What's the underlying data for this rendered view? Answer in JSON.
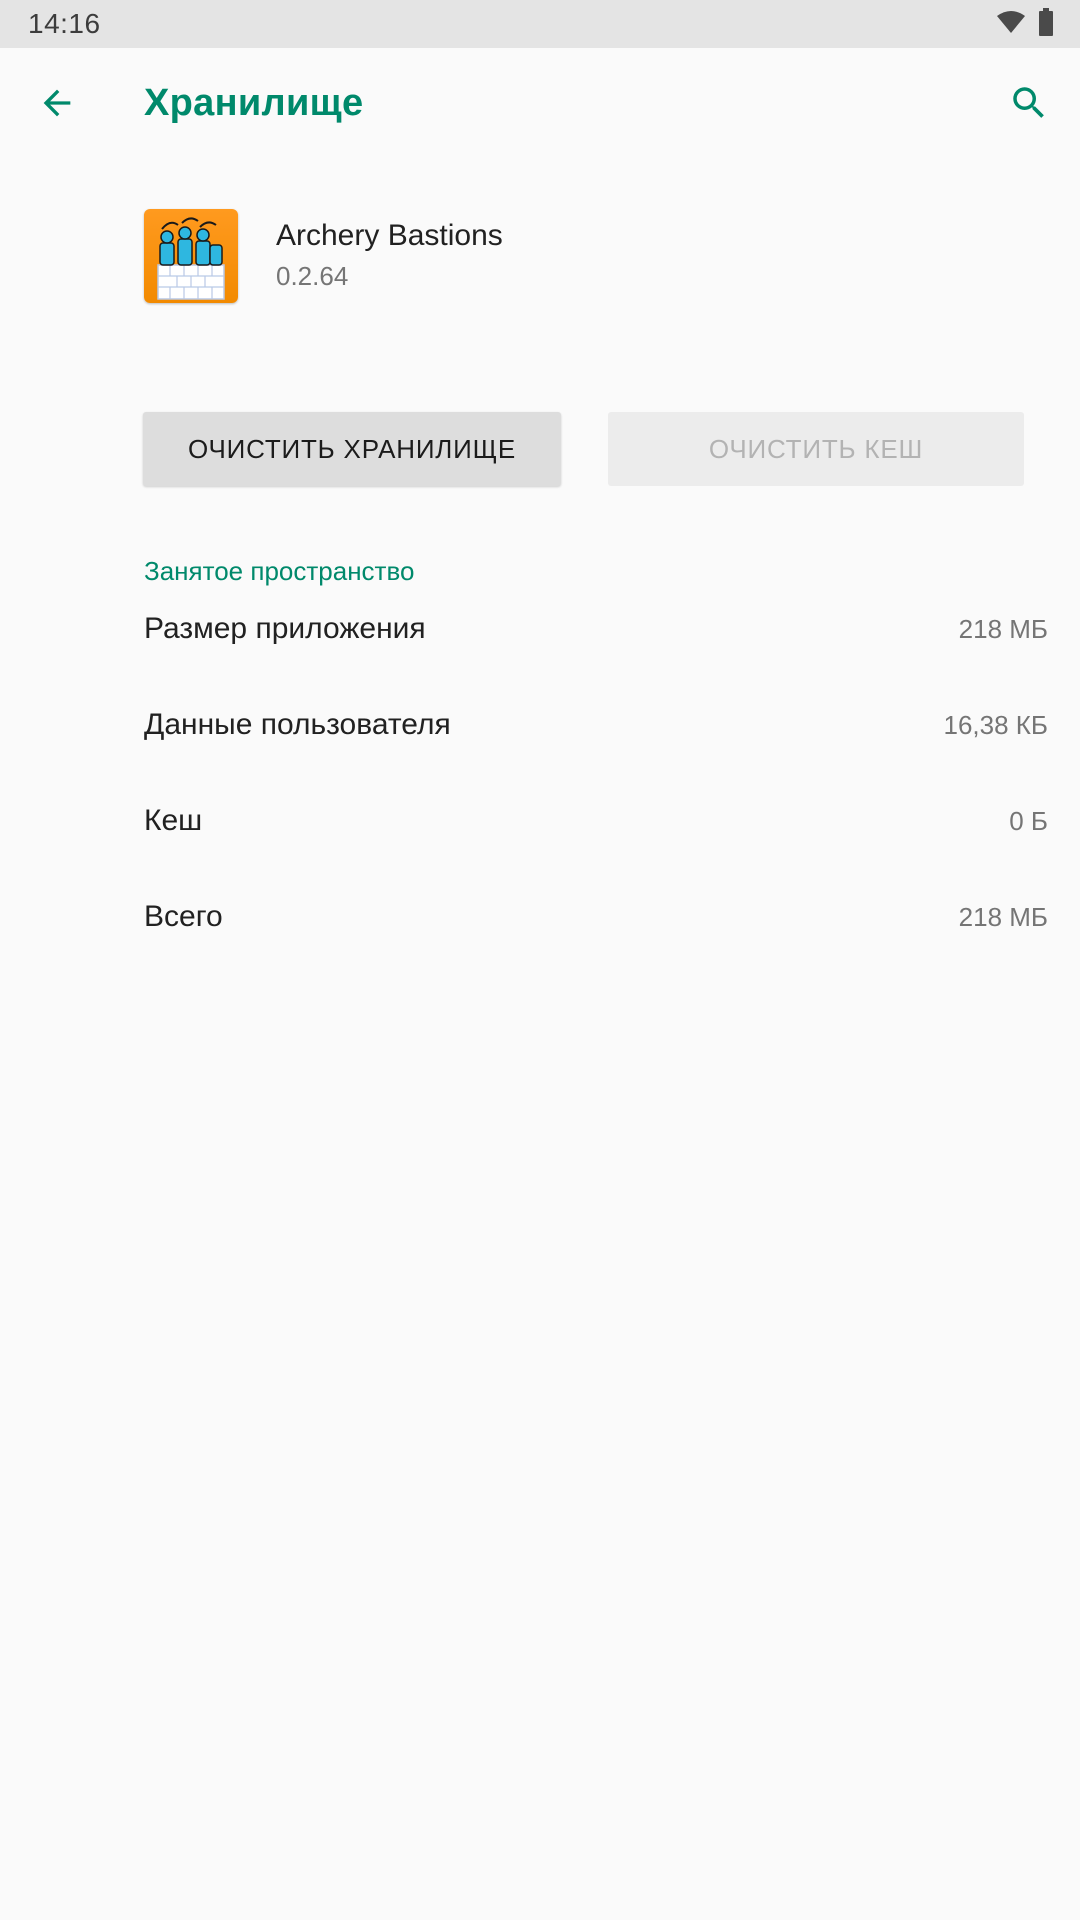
{
  "status_bar": {
    "time": "14:16",
    "icons": [
      "wifi-icon",
      "battery-icon"
    ]
  },
  "app_bar": {
    "title": "Хранилище",
    "back_icon": "arrow-back-icon",
    "search_icon": "search-icon"
  },
  "app": {
    "name": "Archery Bastions",
    "version": "0.2.64",
    "icon": "archery-bastions-app-icon"
  },
  "buttons": {
    "clear_storage": "ОЧИСТИТЬ ХРАНИЛИЩЕ",
    "clear_cache": "ОЧИСТИТЬ КЕШ"
  },
  "section": {
    "title": "Занятое пространство"
  },
  "storage": {
    "rows": [
      {
        "label": "Размер приложения",
        "value": "218 МБ"
      },
      {
        "label": "Данные пользователя",
        "value": "16,38 КБ"
      },
      {
        "label": "Кеш",
        "value": "0 Б"
      },
      {
        "label": "Всего",
        "value": "218 МБ"
      }
    ]
  },
  "colors": {
    "accent": "#00896b",
    "background": "#fafafa",
    "status_bar": "#e4e4e4",
    "disabled_button": "#ececec",
    "enabled_button": "#dddddd"
  }
}
